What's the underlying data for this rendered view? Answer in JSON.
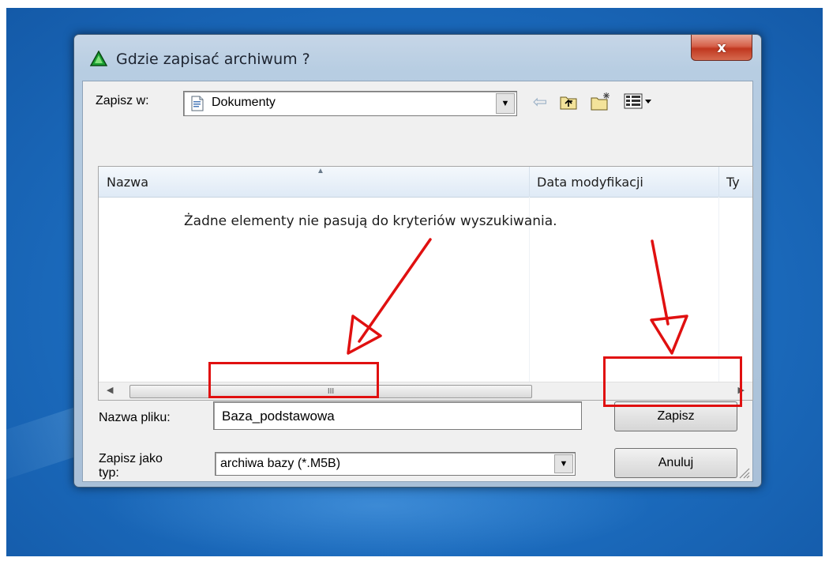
{
  "window": {
    "title": "Gdzie zapisać archiwum ?",
    "close_label": "x"
  },
  "save_in": {
    "label": "Zapisz w:",
    "value": "Dokumenty"
  },
  "toolbar": {
    "icons": [
      "back-arrow-icon",
      "up-folder-icon",
      "new-folder-icon",
      "view-menu-icon"
    ]
  },
  "list": {
    "columns": [
      "Nazwa",
      "Data modyfikacji",
      "Ty"
    ],
    "empty_message": "Żadne elementy nie pasują do kryteriów wyszukiwania.",
    "scroll_thumb_glyph": "III"
  },
  "filename": {
    "label": "Nazwa pliku:",
    "value": "Baza_podstawowa"
  },
  "filetype": {
    "label": "Zapisz jako typ:",
    "value": "archiwa bazy (*.M5B)"
  },
  "buttons": {
    "save": "Zapisz",
    "cancel": "Anuluj"
  },
  "colors": {
    "annotation": "#e01010",
    "desktop": "#1d6fc2"
  }
}
